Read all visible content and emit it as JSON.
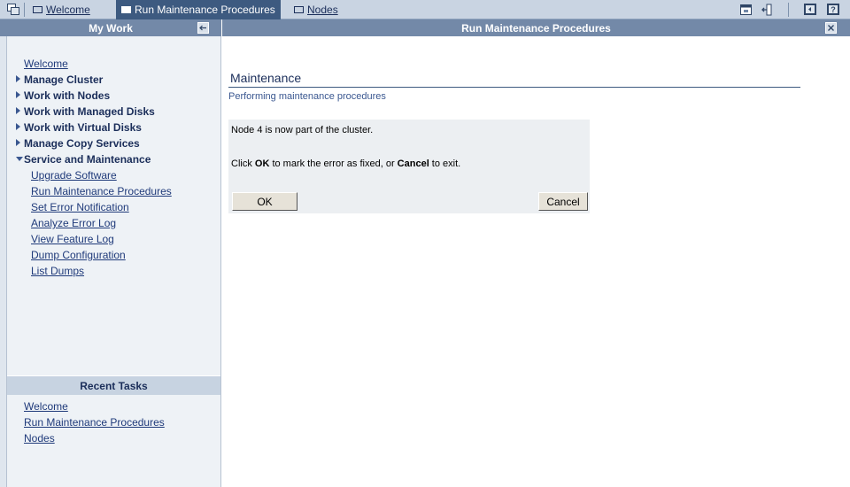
{
  "window_buttons": {
    "home_icon": "windows-icon",
    "calendar_icon": "calendar-icon",
    "logout_icon": "logout-icon",
    "panel_icon": "panel-toggle-icon",
    "help_icon": "help-icon"
  },
  "tabs": [
    {
      "label": "Welcome",
      "active": false
    },
    {
      "label": "Run Maintenance Procedures",
      "active": true
    },
    {
      "label": "Nodes",
      "active": false
    }
  ],
  "left_panel": {
    "title": "My Work",
    "collapse_icon": "collapse-left-icon",
    "items": [
      {
        "label": "Welcome",
        "type": "link"
      },
      {
        "label": "Manage Cluster",
        "type": "group",
        "expanded": false
      },
      {
        "label": "Work with Nodes",
        "type": "group",
        "expanded": false
      },
      {
        "label": "Work with Managed Disks",
        "type": "group",
        "expanded": false
      },
      {
        "label": "Work with Virtual Disks",
        "type": "group",
        "expanded": false
      },
      {
        "label": "Manage Copy Services",
        "type": "group",
        "expanded": false
      },
      {
        "label": "Service and Maintenance",
        "type": "group",
        "expanded": true
      }
    ],
    "sub_items": [
      "Upgrade Software",
      "Run Maintenance Procedures",
      "Set Error Notification",
      "Analyze Error Log",
      "View Feature Log",
      "Dump Configuration",
      "List Dumps"
    ]
  },
  "recent_tasks": {
    "title": "Recent Tasks",
    "items": [
      "Welcome",
      "Run Maintenance Procedures",
      "Nodes"
    ]
  },
  "main_panel": {
    "title": "Run Maintenance Procedures",
    "close_icon": "close-icon"
  },
  "content": {
    "heading": "Maintenance",
    "subheading": "Performing maintenance procedures",
    "message": "Node 4 is now part of the cluster.",
    "instruction_prefix": "Click ",
    "instruction_ok": "OK",
    "instruction_middle": " to mark the error as fixed, or ",
    "instruction_cancel": "Cancel",
    "instruction_suffix": " to exit.",
    "ok_button": "OK",
    "cancel_button": "Cancel"
  },
  "colors": {
    "topbar": "#c9d4e2",
    "active_tab": "#3d5a80",
    "panel_header": "#7389a8",
    "nav_background": "#eef2f6",
    "link": "#1f3a7a"
  }
}
